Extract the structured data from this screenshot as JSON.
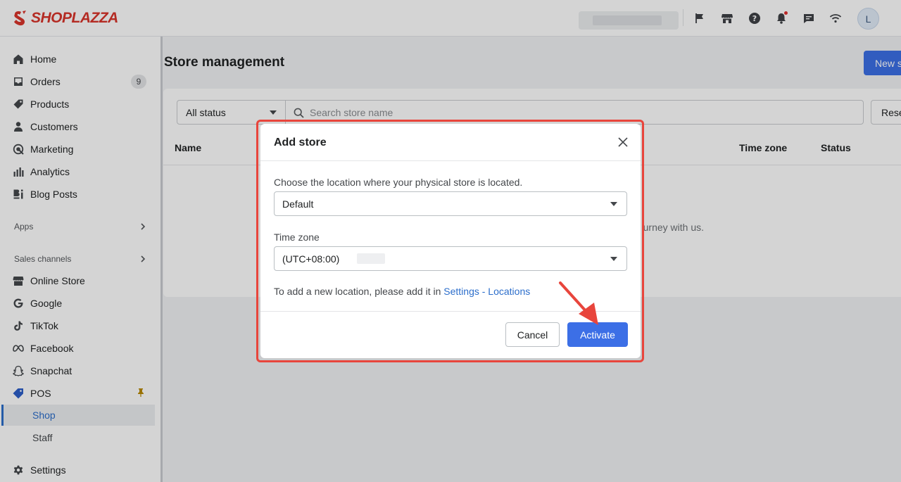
{
  "brand": {
    "name": "SHOPLAZZA",
    "color": "#d9342b"
  },
  "topbar": {
    "icons": [
      "flag-icon",
      "store-icon",
      "help-icon",
      "bell-icon",
      "chat-icon",
      "wifi-icon"
    ],
    "avatar_initial": "L"
  },
  "sidebar": {
    "items": [
      {
        "label": "Home",
        "icon": "home-icon"
      },
      {
        "label": "Orders",
        "icon": "orders-icon",
        "badge": "9"
      },
      {
        "label": "Products",
        "icon": "tag-icon"
      },
      {
        "label": "Customers",
        "icon": "person-icon"
      },
      {
        "label": "Marketing",
        "icon": "target-icon"
      },
      {
        "label": "Analytics",
        "icon": "bar-chart-icon"
      },
      {
        "label": "Blog Posts",
        "icon": "blog-icon"
      }
    ],
    "apps_label": "Apps",
    "sales_channels_label": "Sales channels",
    "channels": [
      {
        "label": "Online Store",
        "icon": "store-icon"
      },
      {
        "label": "Google",
        "icon": "google-icon"
      },
      {
        "label": "TikTok",
        "icon": "tiktok-icon"
      },
      {
        "label": "Facebook",
        "icon": "meta-icon"
      },
      {
        "label": "Snapchat",
        "icon": "snapchat-icon"
      },
      {
        "label": "POS",
        "icon": "pos-icon"
      }
    ],
    "pos_sub": [
      {
        "label": "Shop",
        "active": true
      },
      {
        "label": "Staff",
        "active": false
      }
    ],
    "settings_label": "Settings"
  },
  "main": {
    "title": "Store management",
    "new_button": "New s",
    "filter": {
      "status": "All status",
      "search_placeholder": "Search store name",
      "reset": "Rese"
    },
    "columns": {
      "name": "Name",
      "time_zone": "Time zone",
      "status": "Status"
    },
    "empty_text": "urney with us."
  },
  "modal": {
    "title": "Add store",
    "location_label": "Choose the location where your physical store is located.",
    "location_value": "Default",
    "timezone_label": "Time zone",
    "timezone_value": "(UTC+08:00)",
    "hint_prefix": "To add a new location, please add it in ",
    "hint_link": "Settings - Locations",
    "cancel": "Cancel",
    "activate": "Activate"
  },
  "colors": {
    "primary": "#3c6fe6",
    "link": "#2c6ecb",
    "highlight": "#e8453c"
  }
}
